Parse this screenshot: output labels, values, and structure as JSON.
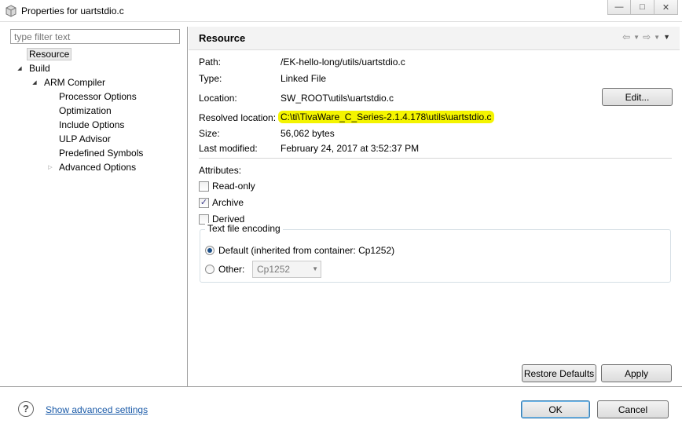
{
  "window": {
    "title": "Properties for uartstdio.c"
  },
  "filter": {
    "placeholder": "type filter text"
  },
  "tree": {
    "resource": "Resource",
    "build": "Build",
    "arm_compiler": "ARM Compiler",
    "processor_options": "Processor Options",
    "optimization": "Optimization",
    "include_options": "Include Options",
    "ulp_advisor": "ULP Advisor",
    "predefined_symbols": "Predefined Symbols",
    "advanced_options": "Advanced Options"
  },
  "page": {
    "title": "Resource"
  },
  "info": {
    "path_label": "Path:",
    "path_value": "/EK-hello-long/utils/uartstdio.c",
    "type_label": "Type:",
    "type_value": "Linked File",
    "location_label": "Location:",
    "location_value": "SW_ROOT\\utils\\uartstdio.c",
    "resolved_label": "Resolved location:",
    "resolved_value": "C:\\ti\\TivaWare_C_Series-2.1.4.178\\utils\\uartstdio.c",
    "size_label": "Size:",
    "size_value": "56,062  bytes",
    "modified_label": "Last modified:",
    "modified_value": "February 24, 2017 at 3:52:37 PM",
    "edit_button": "Edit..."
  },
  "attributes": {
    "label": "Attributes:",
    "readonly": {
      "label": "Read-only",
      "checked": false
    },
    "archive": {
      "label": "Archive",
      "checked": true
    },
    "derived": {
      "label": "Derived",
      "checked": false
    }
  },
  "encoding": {
    "title": "Text file encoding",
    "default_label": "Default (inherited from container: Cp1252)",
    "other_label": "Other:",
    "other_value": "Cp1252",
    "selected": "default"
  },
  "buttons": {
    "restore_defaults": "Restore Defaults",
    "apply": "Apply",
    "ok": "OK",
    "cancel": "Cancel"
  },
  "footer": {
    "advanced_link": "Show advanced settings"
  },
  "colors": {
    "highlight": "#f4f400",
    "link": "#1a5aa8"
  }
}
